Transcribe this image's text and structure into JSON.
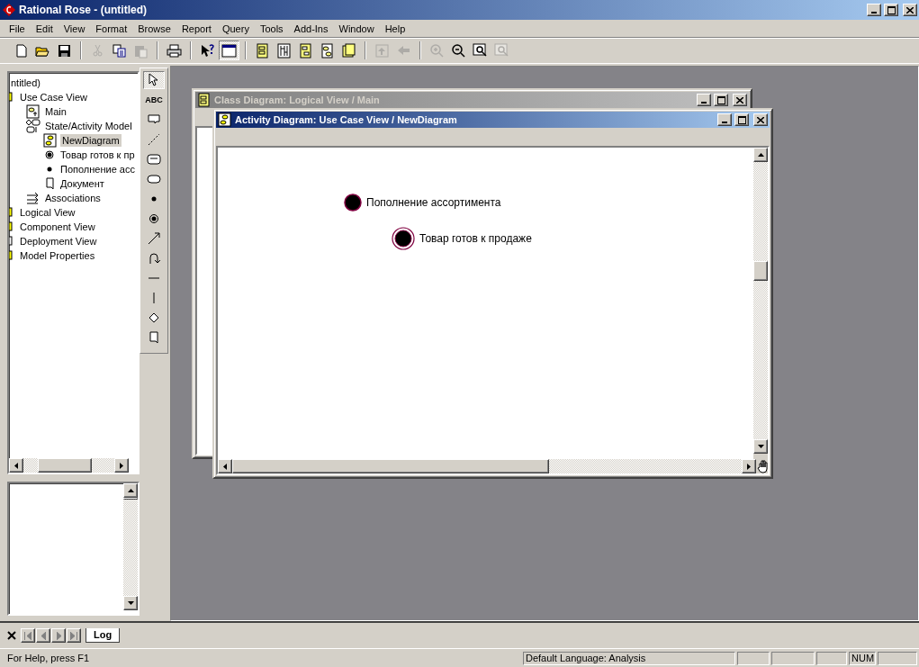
{
  "window": {
    "title": "Rational Rose - (untitled)"
  },
  "menu": [
    "File",
    "Edit",
    "View",
    "Format",
    "Browse",
    "Report",
    "Query",
    "Tools",
    "Add-Ins",
    "Window",
    "Help"
  ],
  "toolbar": [
    {
      "kind": "new",
      "disabled": false
    },
    {
      "kind": "open",
      "disabled": false
    },
    {
      "kind": "save",
      "disabled": false
    },
    {
      "kind": "sep"
    },
    {
      "kind": "cut",
      "disabled": true
    },
    {
      "kind": "copy",
      "disabled": false
    },
    {
      "kind": "paste",
      "disabled": true
    },
    {
      "kind": "sep"
    },
    {
      "kind": "print",
      "disabled": false
    },
    {
      "kind": "sep"
    },
    {
      "kind": "help",
      "disabled": false
    },
    {
      "kind": "window",
      "disabled": false,
      "pressed": true
    },
    {
      "kind": "sep"
    },
    {
      "kind": "class",
      "disabled": false
    },
    {
      "kind": "sequence",
      "disabled": false
    },
    {
      "kind": "collab",
      "disabled": false
    },
    {
      "kind": "state",
      "disabled": false
    },
    {
      "kind": "component",
      "disabled": false
    },
    {
      "kind": "sep"
    },
    {
      "kind": "up",
      "disabled": true
    },
    {
      "kind": "back",
      "disabled": true
    },
    {
      "kind": "sep"
    },
    {
      "kind": "zoomin",
      "disabled": true
    },
    {
      "kind": "zoomout",
      "disabled": false
    },
    {
      "kind": "fit",
      "disabled": false
    },
    {
      "kind": "undofit",
      "disabled": true
    }
  ],
  "tree": [
    {
      "label": "ntitled)",
      "children": [
        {
          "label": "Use Case View",
          "kind": "package",
          "selected": false,
          "children": [
            {
              "label": "Main",
              "kind": "usecase-diagram",
              "selected": false
            },
            {
              "label": "State/Activity Model",
              "kind": "model",
              "selected": false,
              "children": [
                {
                  "label": "NewDiagram",
                  "kind": "activity-diagram",
                  "selected": true
                },
                {
                  "label": "Товар готов к пр",
                  "kind": "end",
                  "selected": false
                },
                {
                  "label": "Пополнение асс",
                  "kind": "start",
                  "selected": false
                },
                {
                  "label": "Документ",
                  "kind": "object",
                  "selected": false
                }
              ]
            },
            {
              "label": "Associations",
              "kind": "associations",
              "selected": false
            }
          ]
        },
        {
          "label": "Logical View",
          "kind": "package",
          "selected": false
        },
        {
          "label": "Component View",
          "kind": "package",
          "selected": false
        },
        {
          "label": "Deployment View",
          "kind": "deploy",
          "selected": false
        },
        {
          "label": "Model Properties",
          "kind": "package",
          "selected": false
        }
      ]
    }
  ],
  "toolbox": [
    {
      "kind": "selector",
      "selected": true
    },
    {
      "kind": "text",
      "label": "ABC",
      "selected": false
    },
    {
      "kind": "note",
      "selected": false
    },
    {
      "kind": "anchor",
      "selected": false
    },
    {
      "kind": "state",
      "selected": false
    },
    {
      "kind": "activity",
      "selected": false
    },
    {
      "kind": "start",
      "selected": false
    },
    {
      "kind": "end",
      "selected": false
    },
    {
      "kind": "transition",
      "selected": false
    },
    {
      "kind": "self",
      "selected": false
    },
    {
      "kind": "hsync",
      "selected": false
    },
    {
      "kind": "vsync",
      "selected": false
    },
    {
      "kind": "decision",
      "selected": false
    },
    {
      "kind": "object",
      "selected": false
    }
  ],
  "windows": [
    {
      "title": "Class Diagram: Logical View / Main",
      "kind": "class",
      "active": false
    },
    {
      "title": "Activity Diagram: Use Case View / NewDiagram",
      "kind": "activity",
      "active": true,
      "nodes": [
        {
          "kind": "start",
          "label": "Пополнение ассортимента"
        },
        {
          "kind": "end",
          "label": "Товар готов к продаже"
        }
      ]
    }
  ],
  "log_tab": "Log",
  "status_bar": {
    "help": "For Help, press F1",
    "language": "Default Language: Analysis",
    "num": "NUM"
  }
}
